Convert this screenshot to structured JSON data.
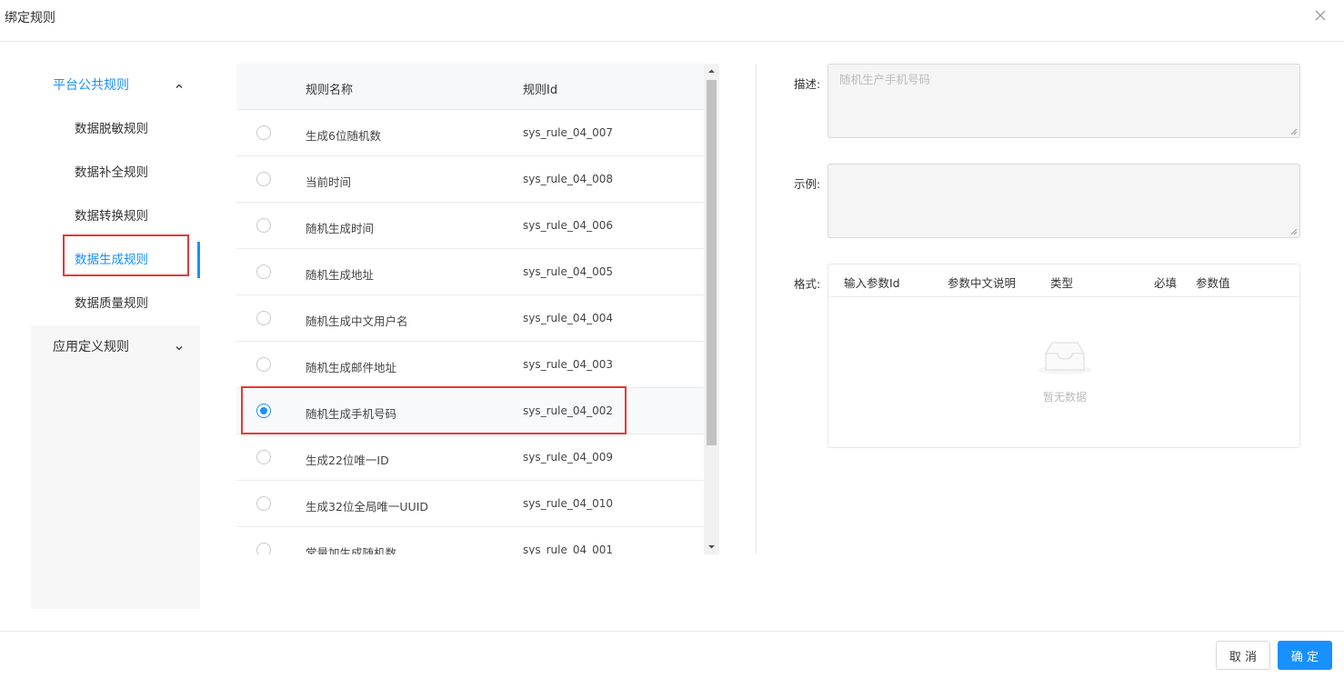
{
  "dialog": {
    "title": "绑定规则"
  },
  "menu": {
    "groups": [
      {
        "label": "平台公共规则",
        "items": [
          "数据脱敏规则",
          "数据补全规则",
          "数据转换规则",
          "数据生成规则",
          "数据质量规则"
        ],
        "active_item": "数据生成规则"
      },
      {
        "label": "应用定义规则"
      }
    ]
  },
  "rules_table": {
    "columns": [
      "规则名称",
      "规则Id"
    ],
    "rows": [
      {
        "name": "生成6位随机数",
        "id": "sys_rule_04_007",
        "selected": false
      },
      {
        "name": "当前时间",
        "id": "sys_rule_04_008",
        "selected": false
      },
      {
        "name": "随机生成时间",
        "id": "sys_rule_04_006",
        "selected": false
      },
      {
        "name": "随机生成地址",
        "id": "sys_rule_04_005",
        "selected": false
      },
      {
        "name": "随机生成中文用户名",
        "id": "sys_rule_04_004",
        "selected": false
      },
      {
        "name": "随机生成邮件地址",
        "id": "sys_rule_04_003",
        "selected": false
      },
      {
        "name": "随机生成手机号码",
        "id": "sys_rule_04_002",
        "selected": true
      },
      {
        "name": "生成22位唯一ID",
        "id": "sys_rule_04_009",
        "selected": false
      },
      {
        "name": "生成32位全局唯一UUID",
        "id": "sys_rule_04_010",
        "selected": false
      },
      {
        "name": "常量加生成随机数",
        "id": "sys_rule_04_001",
        "selected": false
      }
    ]
  },
  "detail": {
    "description_label": "描述:",
    "description_value": "随机生产手机号码",
    "example_label": "示例:",
    "example_value": "",
    "format_label": "格式:",
    "format_columns": [
      "输入参数Id",
      "参数中文说明",
      "类型",
      "必填",
      "参数值"
    ],
    "empty_text": "暂无数据"
  },
  "footer": {
    "cancel_label": "取 消",
    "ok_label": "确 定"
  },
  "colors": {
    "accent": "#1890ff",
    "highlight": "#e53935"
  }
}
